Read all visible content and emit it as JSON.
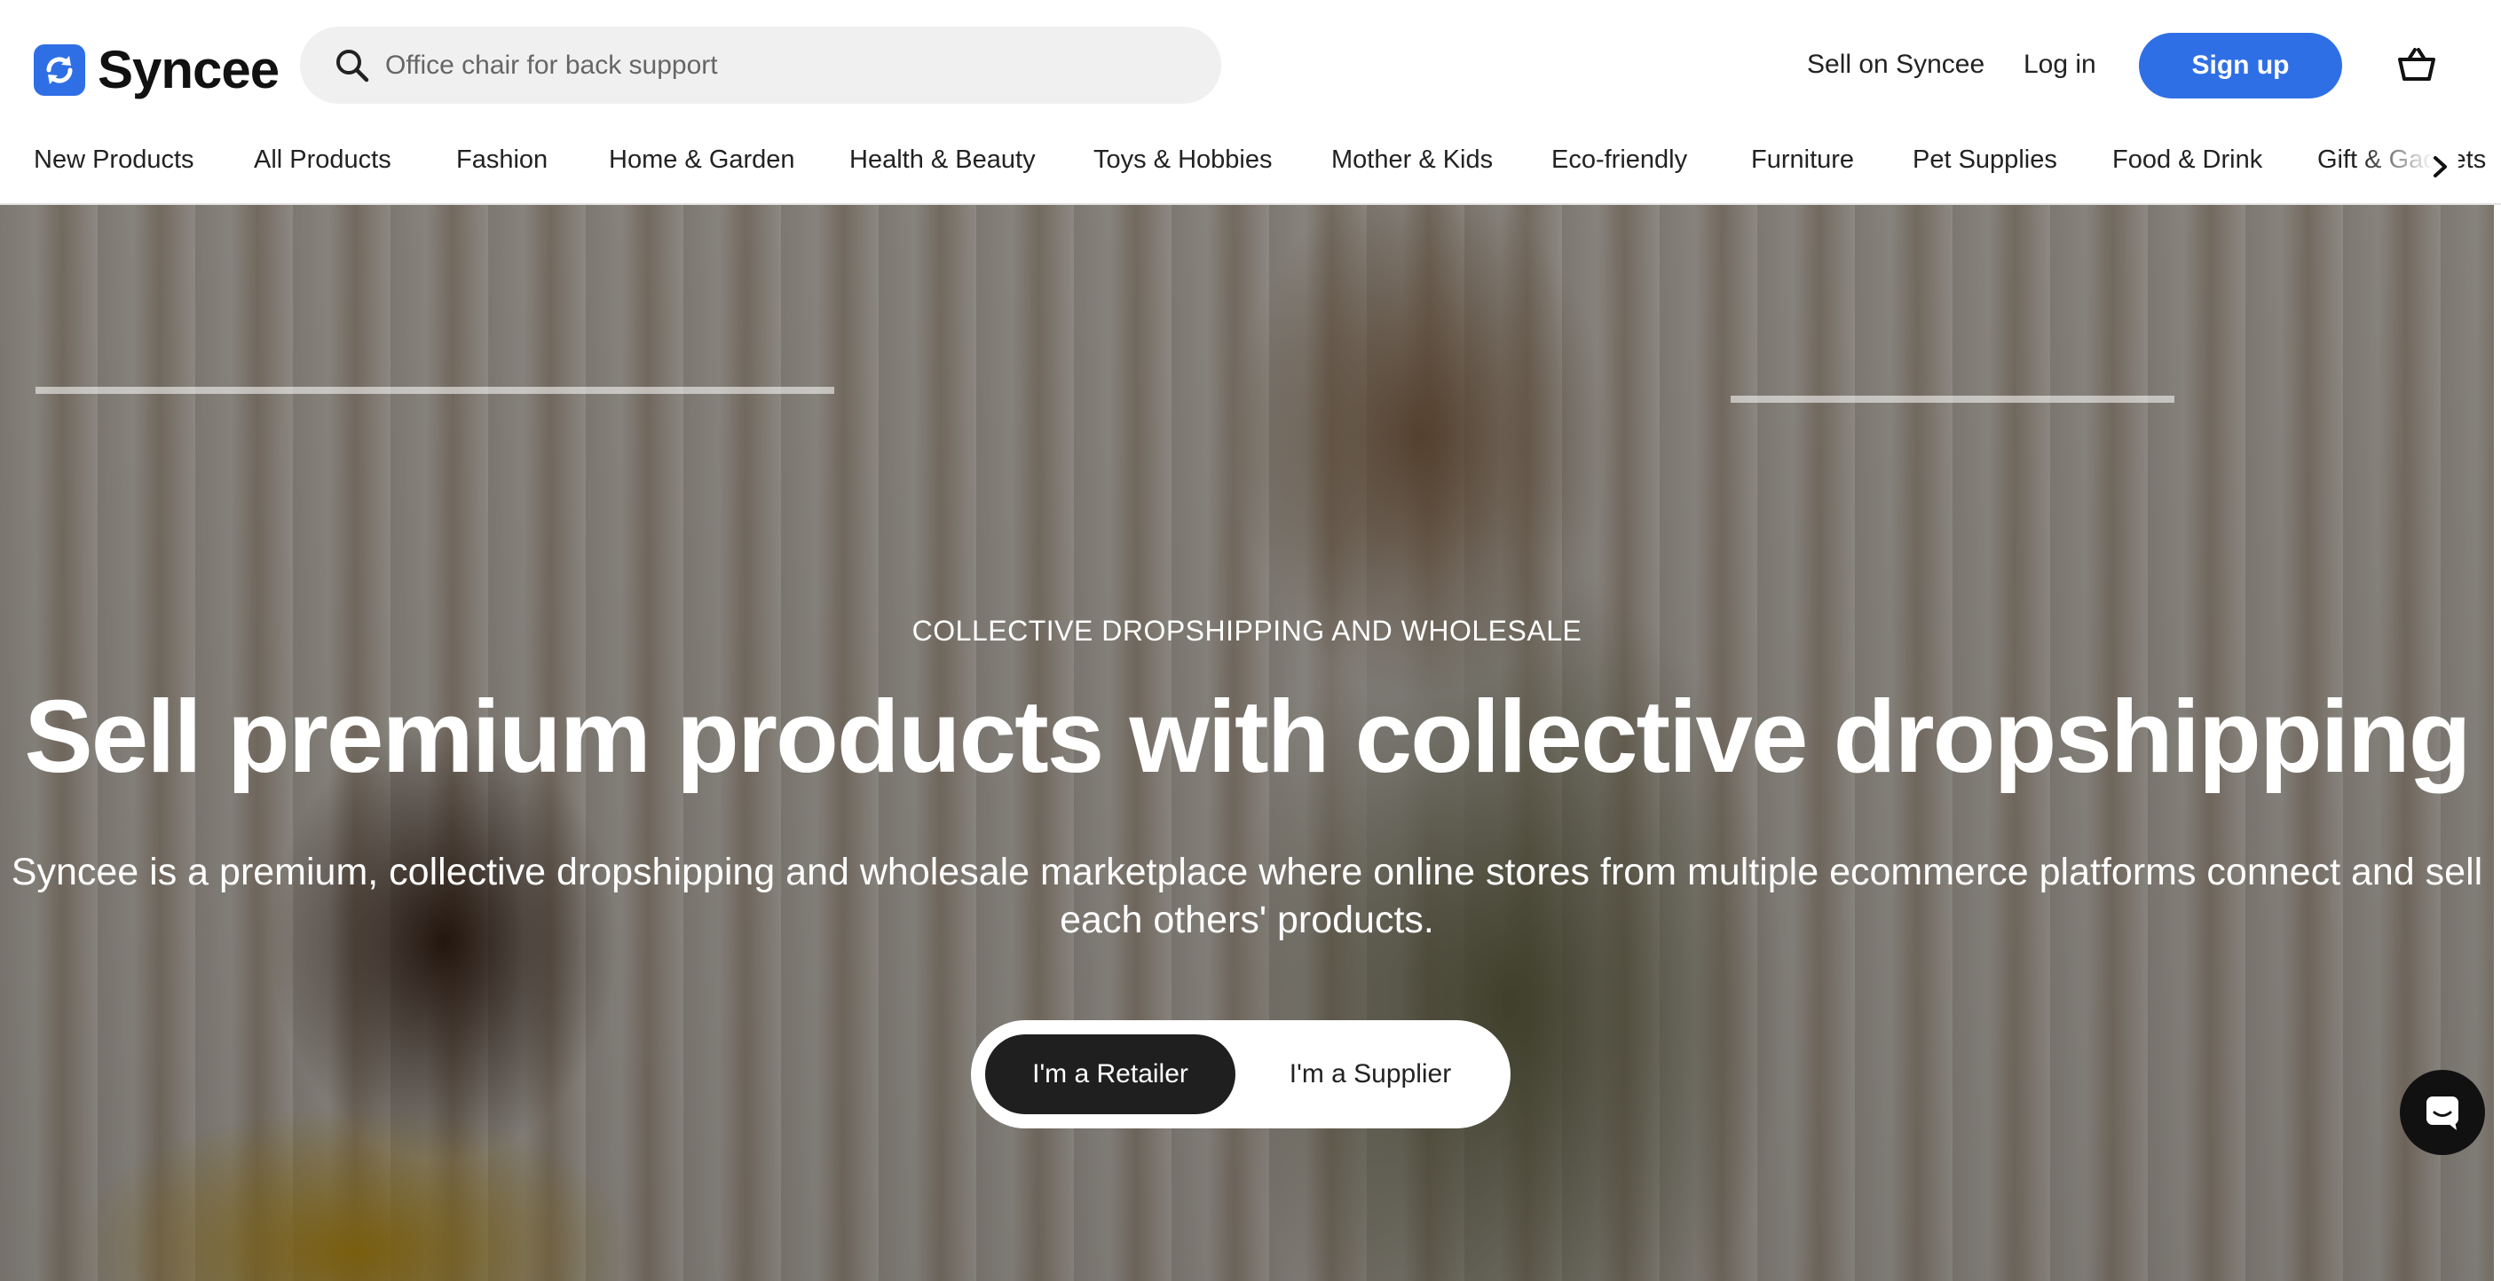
{
  "header": {
    "brand": "Syncee",
    "search_placeholder": "Office chair for back support",
    "sell_link": "Sell on Syncee",
    "login": "Log in",
    "signup": "Sign up",
    "icons": [
      "logo-mark-icon",
      "search-icon",
      "cart-icon"
    ]
  },
  "categories": {
    "items": [
      "New Products",
      "All Products",
      "Fashion",
      "Home & Garden",
      "Health & Beauty",
      "Toys & Hobbies",
      "Mother & Kids",
      "Eco-friendly",
      "Furniture",
      "Pet Supplies",
      "Food & Drink",
      "Gift & Gadgets"
    ],
    "next_icon": "chevron-right-icon"
  },
  "hero": {
    "eyebrow": "COLLECTIVE DROPSHIPPING AND WHOLESALE",
    "headline": "Sell premium products with collective dropshipping",
    "subtext": "Syncee is a premium, collective dropshipping and wholesale marketplace where online stores from multiple ecommerce platforms connect and sell each others' products.",
    "toggle": {
      "retailer": "I'm a Retailer",
      "supplier": "I'm a Supplier",
      "selected": "retailer"
    }
  },
  "chat": {
    "icon": "chat-icon"
  },
  "colors": {
    "accent": "#2f6fe6",
    "toggle_active": "#1f1f1f",
    "text": "#222222"
  }
}
